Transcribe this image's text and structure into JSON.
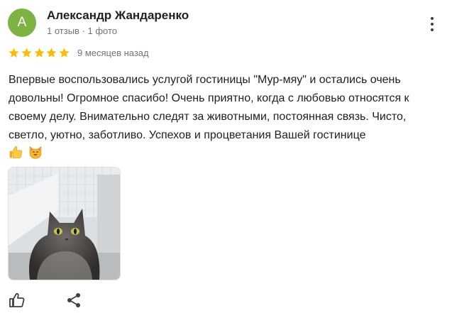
{
  "review": {
    "avatar_letter": "А",
    "avatar_color": "#7cb342",
    "author_name": "Александр Жандаренко",
    "meta": "1 отзыв · 1 фото",
    "rating": 5,
    "star_color": "#fbbc04",
    "time_ago": "9 месяцев назад",
    "text": "Впервые воспользовались услугой гостиницы \"Мур-мяу\" и остались очень довольны! Огромное спасибо! Очень приятно, когда с любовью относятся к своему делу. Внимательно следят за животными, постоянная связь. Чисто, светло, уютно, заботливо. Успехов и процветания Вашей гостинице"
  },
  "emojis": [
    "thumbs-up",
    "smiling-cat-face"
  ],
  "photo": {
    "subject": "cat-photo"
  },
  "actions": {
    "like_icon": "thumbs-up-icon",
    "share_icon": "share-icon"
  }
}
